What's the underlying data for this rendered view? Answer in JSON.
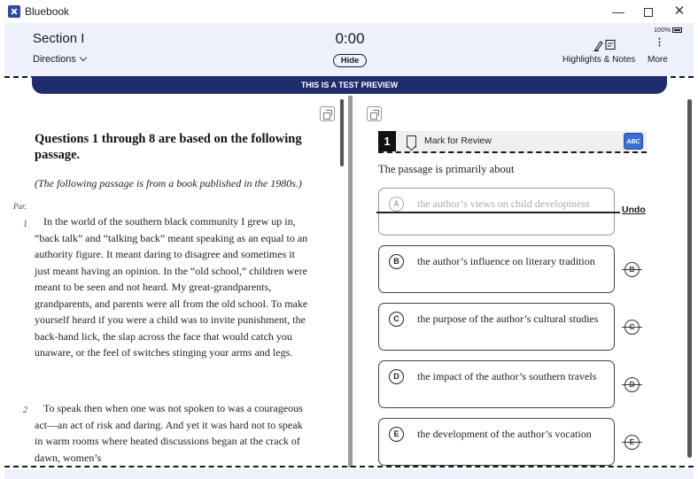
{
  "window": {
    "title": "Bluebook",
    "minimize": "—",
    "close": "✕"
  },
  "header": {
    "section_title": "Section I",
    "directions_label": "Directions",
    "timer": "0:00",
    "hide_label": "Hide",
    "highlights_notes_label": "Highlights & Notes",
    "battery": "100%",
    "more_label": "More",
    "more_dots": "⋮"
  },
  "banner": {
    "text": "THIS IS A TEST PREVIEW"
  },
  "passage": {
    "heading": "Questions 1 through 8 are based on the following passage.",
    "intro": "(The following passage is from a book published in the 1980s.)",
    "par_label": "Par.",
    "paragraphs": [
      {
        "number": "1",
        "text": "In the world of the southern black community I grew up in, “back talk” and “talking back” meant speaking as an equal to an authority figure. It meant daring to disagree and sometimes it just meant having an opinion. In the “old school,” children were meant to be seen and not heard. My great-grandparents, grandparents, and parents were all from the old school. To make yourself heard if you were a child was to invite punishment, the back-hand lick, the slap across the face that would catch you unaware, or the feel of switches stinging your arms and legs."
      },
      {
        "number": "2",
        "text": "To speak then when one was not spoken to was a courageous act—an act of risk and daring. And yet it was hard not to speak in warm rooms where heated discussions began at the crack of dawn, women’s"
      }
    ]
  },
  "question": {
    "number": "1",
    "mark_label": "Mark for Review",
    "abc_label": "ABC",
    "prompt": "The passage is primarily about",
    "undo_label": "Undo",
    "options": [
      {
        "letter": "A",
        "text": "the author’s views on child development",
        "crossed_out": true
      },
      {
        "letter": "B",
        "text": "the author’s influence on literary tradition",
        "crossed_out": false
      },
      {
        "letter": "C",
        "text": "the purpose of the author’s cultural studies",
        "crossed_out": false
      },
      {
        "letter": "D",
        "text": "the impact of the author’s southern travels",
        "crossed_out": false
      },
      {
        "letter": "E",
        "text": "the development of the author’s vocation",
        "crossed_out": false
      }
    ]
  },
  "icons": {
    "logo": "bluebook-logo-icon",
    "expand": "expand-icon",
    "collapse": "collapse-icon",
    "bookmark": "bookmark-icon",
    "highlight": "pen-highlight-icon",
    "notes": "notes-icon",
    "battery": "battery-icon"
  },
  "colors": {
    "banner_bg": "#1e2d6e",
    "header_bg": "#eef1fb",
    "abc_button": "#3b6dd6"
  }
}
